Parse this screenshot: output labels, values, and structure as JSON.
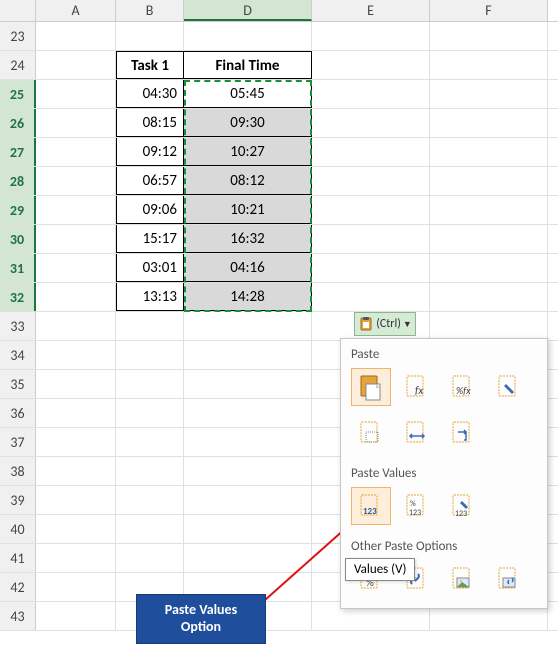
{
  "columns": [
    "A",
    "B",
    "D",
    "E",
    "F"
  ],
  "visible_row_start": 23,
  "visible_row_end": 43,
  "selected_column": "D",
  "selected_rows": [
    25,
    26,
    27,
    28,
    29,
    30,
    31,
    32
  ],
  "table": {
    "header_row": 24,
    "headers": {
      "B": "Task 1",
      "D": "Final Time"
    },
    "rows": [
      {
        "r": 25,
        "B": "04:30",
        "D": "05:45",
        "gray": false
      },
      {
        "r": 26,
        "B": "08:15",
        "D": "09:30",
        "gray": true
      },
      {
        "r": 27,
        "B": "09:12",
        "D": "10:27",
        "gray": true
      },
      {
        "r": 28,
        "B": "06:57",
        "D": "08:12",
        "gray": true
      },
      {
        "r": 29,
        "B": "09:06",
        "D": "10:21",
        "gray": true
      },
      {
        "r": 30,
        "B": "15:17",
        "D": "16:32",
        "gray": true
      },
      {
        "r": 31,
        "B": "03:01",
        "D": "04:16",
        "gray": true
      },
      {
        "r": 32,
        "B": "13:13",
        "D": "14:28",
        "gray": true
      }
    ]
  },
  "paste_button": {
    "label": "(Ctrl)"
  },
  "paste_menu": {
    "section_paste": "Paste",
    "section_values": "Paste Values",
    "section_other": "Other Paste Options",
    "icons_paste_row1": [
      "paste",
      "formulas",
      "formulas-number-format",
      "keep-source-format"
    ],
    "icons_paste_row2": [
      "no-borders",
      "keep-col-width",
      "transpose"
    ],
    "icons_values": [
      "values",
      "values-number-format",
      "values-source-format"
    ],
    "icons_other": [
      "formatting",
      "paste-link",
      "picture",
      "linked-picture"
    ],
    "labels": {
      "values_123": "123",
      "values_pct": "%",
      "values_brush": ""
    }
  },
  "tooltip": {
    "text": "Values (V)"
  },
  "callout": {
    "line1": "Paste Values",
    "line2": "Option"
  },
  "chart_data": {
    "type": "table",
    "title": "",
    "columns": [
      "Task 1",
      "Final Time"
    ],
    "rows": [
      [
        "04:30",
        "05:45"
      ],
      [
        "08:15",
        "09:30"
      ],
      [
        "09:12",
        "10:27"
      ],
      [
        "06:57",
        "08:12"
      ],
      [
        "09:06",
        "10:21"
      ],
      [
        "15:17",
        "16:32"
      ],
      [
        "03:01",
        "04:16"
      ],
      [
        "13:13",
        "14:28"
      ]
    ]
  }
}
